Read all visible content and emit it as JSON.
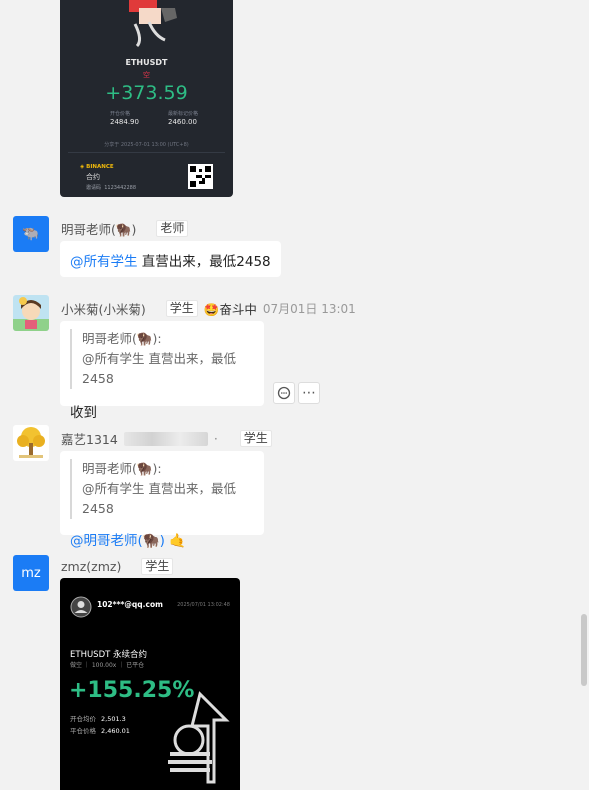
{
  "image_card_1": {
    "symbol": "ETHUSDT",
    "side": "空",
    "pnl": "+373.59",
    "open_price_label": "开仓价格",
    "open_price": "2484.90",
    "mark_price_label": "最新标记价格",
    "mark_price": "2460.00",
    "share_time": "分享于 2025-07-01 13:00 (UTC+8)",
    "brand": "◈ BINANCE",
    "contract": "合约",
    "invite_label": "邀请码",
    "invite_code": "1123442288"
  },
  "messages": [
    {
      "avatar_text": "🐃",
      "name": "明哥老师(🦬)",
      "role": "老师",
      "mention": "@所有学生",
      "text": " 直营出来，最低2458"
    },
    {
      "name": "小米菊(小米菊)",
      "role": "学生",
      "badge": "🤩奋斗中",
      "time": "07月01日 13:01",
      "quote_author": "明哥老师(🦬):",
      "quote_mention": "@所有学生",
      "quote_text": " 直营出来，最低2458",
      "text": "收到",
      "comment_icon": "💬",
      "more_icon": "⋯"
    },
    {
      "name": "嘉艺1314",
      "name_suffix": "·",
      "role": "学生",
      "quote_author": "明哥老师(🦬):",
      "quote_mention": "@所有学生",
      "quote_text": " 直营出来，最低2458",
      "mention": "@明哥老师(🦬)",
      "text": " 🤙"
    },
    {
      "avatar_text": "mz",
      "name": "zmz(zmz)",
      "role": "学生"
    }
  ],
  "image_card_2": {
    "email": "102***@qq.com",
    "timestamp": "2025/07/01 13:02:48",
    "pair": "ETHUSDT 永续合约",
    "meta": "做空 ｜ 100.00x ｜ 已平仓",
    "roe": "+155.25%",
    "open_label": "开仓均价",
    "open_value": "2,501.3",
    "close_label": "平仓价格",
    "close_value": "2,460.01"
  }
}
